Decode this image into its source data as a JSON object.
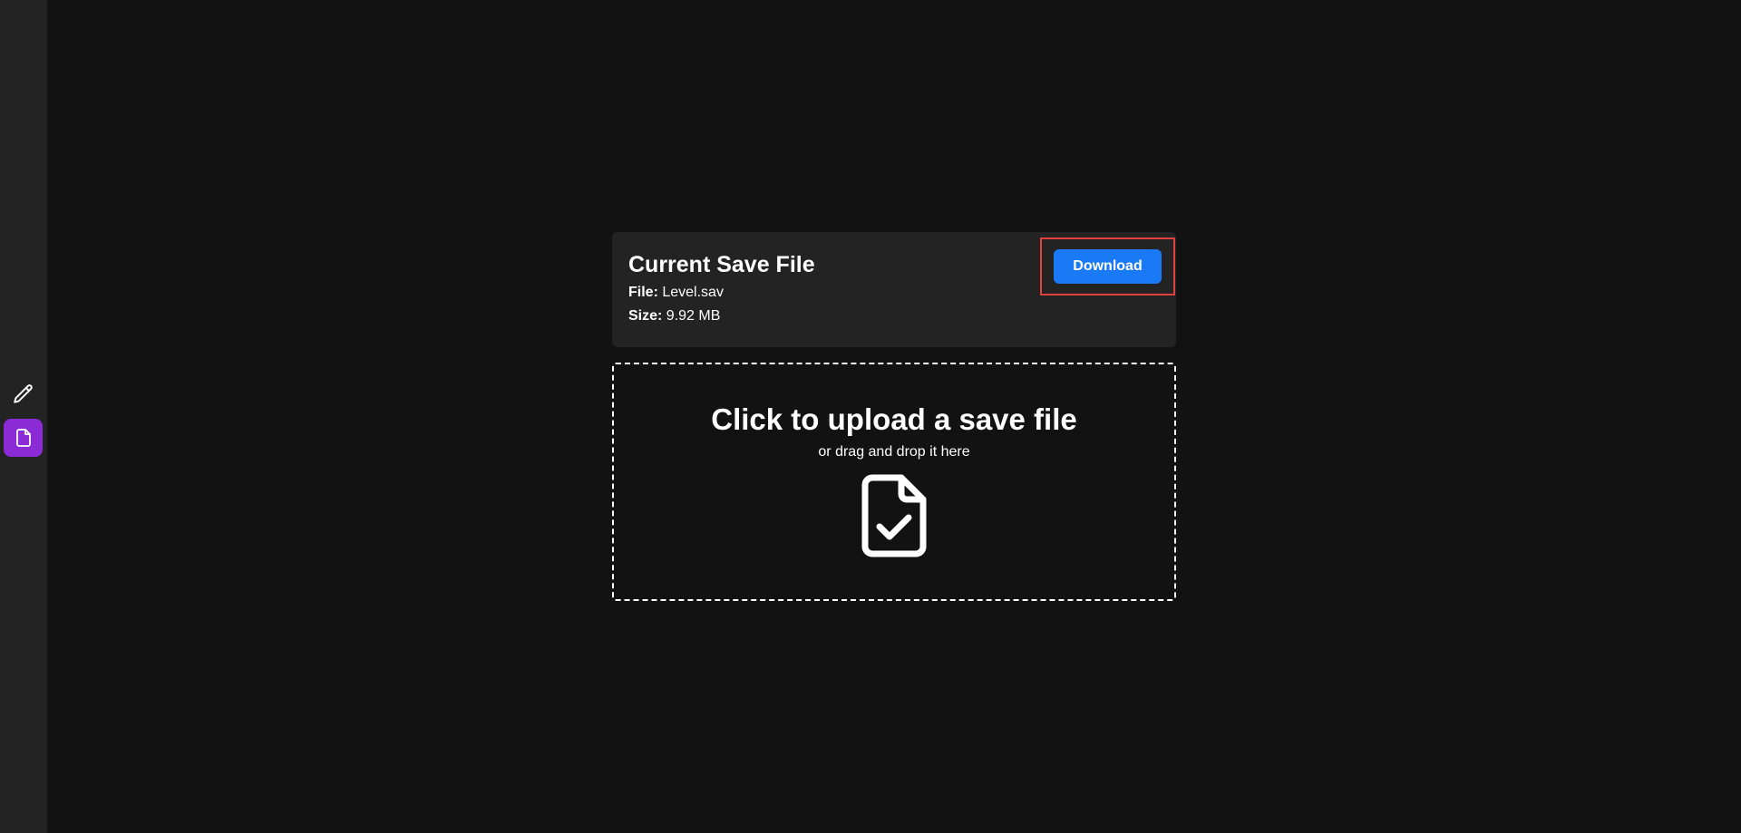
{
  "sidebar": {
    "items": [
      {
        "name": "edit",
        "icon": "pencil-icon",
        "active": false
      },
      {
        "name": "save-file",
        "icon": "file-icon",
        "active": true
      }
    ],
    "active_color": "#8a2bd6"
  },
  "save_card": {
    "title": "Current Save File",
    "file_label": "File:",
    "file_value": "Level.sav",
    "size_label": "Size:",
    "size_value": "9.92 MB",
    "download_label": "Download"
  },
  "upload": {
    "title": "Click to upload a save file",
    "subtitle": "or drag and drop it here",
    "icon": "file-check-icon"
  },
  "colors": {
    "background": "#121212",
    "card": "#232323",
    "accent": "#1a7af5",
    "highlight": "#e2423f"
  }
}
